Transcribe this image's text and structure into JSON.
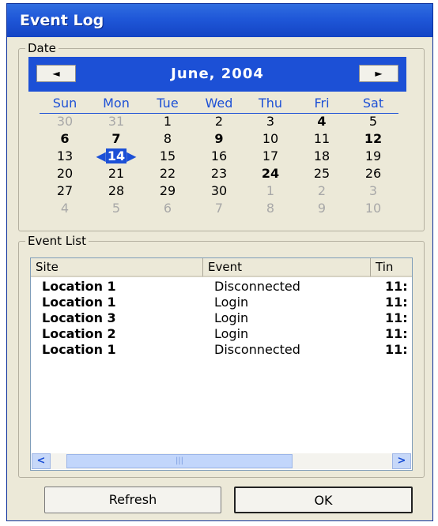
{
  "window": {
    "title": "Event Log"
  },
  "date_group": {
    "label": "Date"
  },
  "calendar": {
    "month_title": "June, 2004",
    "prev_label": "◄",
    "next_label": "►",
    "weekdays": [
      "Sun",
      "Mon",
      "Tue",
      "Wed",
      "Thu",
      "Fri",
      "Sat"
    ],
    "selected_day": "14",
    "weeks": [
      [
        "30",
        "31",
        "1",
        "2",
        "3",
        "4",
        "5"
      ],
      [
        "6",
        "7",
        "8",
        "9",
        "10",
        "11",
        "12"
      ],
      [
        "13",
        "14",
        "15",
        "16",
        "17",
        "18",
        "19"
      ],
      [
        "20",
        "21",
        "22",
        "23",
        "24",
        "25",
        "26"
      ],
      [
        "27",
        "28",
        "29",
        "30",
        "1",
        "2",
        "3"
      ],
      [
        "4",
        "5",
        "6",
        "7",
        "8",
        "9",
        "10"
      ]
    ]
  },
  "event_group": {
    "label": "Event List"
  },
  "event_list": {
    "columns": [
      "Site",
      "Event",
      "Tin"
    ],
    "rows": [
      [
        "Location 1",
        "Disconnected",
        "11:"
      ],
      [
        "Location 1",
        "Login",
        "11:"
      ],
      [
        "Location 3",
        "Login",
        "11:"
      ],
      [
        "Location 2",
        "Login",
        "11:"
      ],
      [
        "Location 1",
        "Disconnected",
        "11:"
      ]
    ],
    "scroll_left": "<",
    "scroll_right": ">",
    "scroll_grip": "|||"
  },
  "buttons": {
    "refresh": "Refresh",
    "ok": "OK"
  },
  "colors": {
    "title_bar": "#1f57d8",
    "calendar_header": "#1c50d6",
    "window_bg": "#ece9d8"
  }
}
